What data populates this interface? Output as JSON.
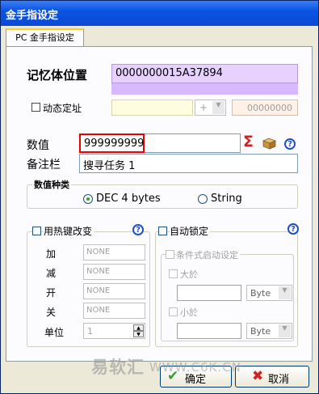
{
  "window": {
    "title": "金手指设定"
  },
  "tabs": [
    {
      "label": "PC 金手指设定"
    }
  ],
  "memory": {
    "label": "记忆体位置",
    "address": "0000000015A37894",
    "dynamic_label": "动态定址",
    "dynamic_checked": false,
    "op_symbol": "+",
    "offset_value": "00000000"
  },
  "value": {
    "label": "数值",
    "input": "999999999",
    "icons": [
      "sigma-icon",
      "package-icon",
      "help-icon"
    ]
  },
  "note": {
    "label": "备注栏",
    "input": "搜寻任务 1"
  },
  "value_type": {
    "title": "数值种类",
    "options": [
      {
        "label": "DEC 4 bytes",
        "selected": true
      },
      {
        "label": "String",
        "selected": false
      }
    ]
  },
  "hotkey": {
    "checkbox_label": "用热键改变",
    "rows": [
      {
        "label": "加",
        "value": "NONE"
      },
      {
        "label": "减",
        "value": "NONE"
      },
      {
        "label": "开",
        "value": "NONE"
      },
      {
        "label": "关",
        "value": "NONE"
      }
    ],
    "unit_label": "单位",
    "unit_value": "1"
  },
  "autolock": {
    "checkbox_label": "自动锁定",
    "condition_label": "条件式启动设定",
    "greater_label": "大於",
    "greater_unit": "Byte",
    "less_label": "小於",
    "less_unit": "Byte"
  },
  "buttons": {
    "ok": "确定",
    "cancel": "取消"
  },
  "watermark": {
    "logo": "易软汇",
    "url": "WWW.C6K.CN"
  },
  "colors": {
    "title_bar": "#0a54e3",
    "address_bg": "#e6d1ff",
    "highlight_border": "#e60000",
    "ok_check": "#3a9a3a",
    "cancel_x": "#d42020"
  }
}
